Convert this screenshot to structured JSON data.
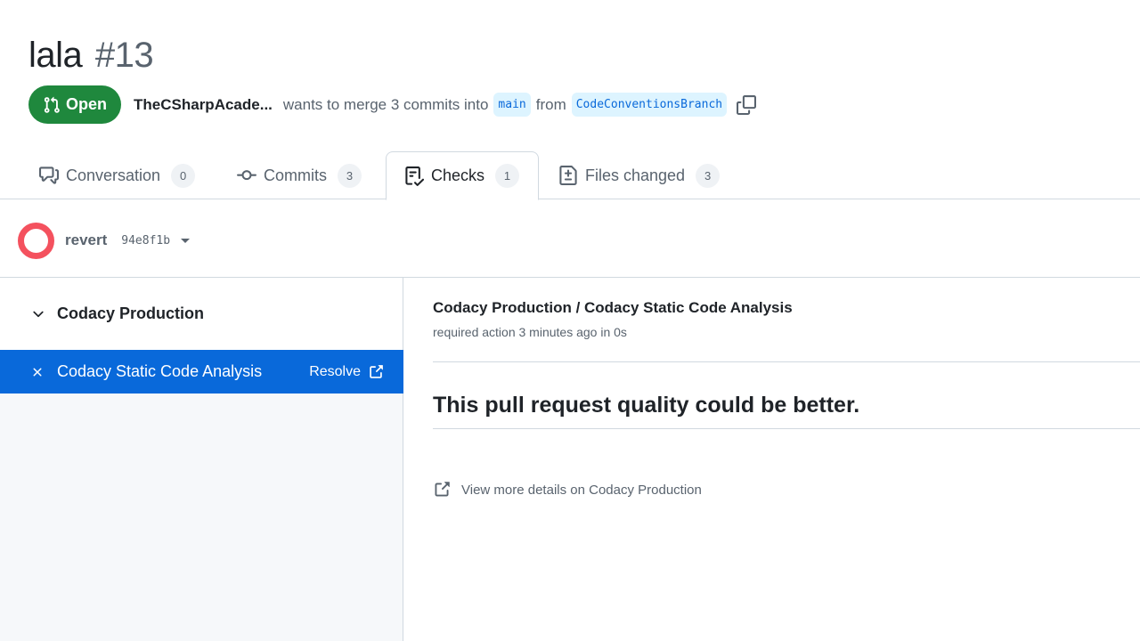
{
  "header": {
    "title": "lala",
    "number": "#13",
    "state": "Open",
    "author": "TheCSharpAcade...",
    "merge_text": "wants to merge 3 commits into",
    "base_branch": "main",
    "from_text": "from",
    "head_branch": "CodeConventionsBranch"
  },
  "tabs": [
    {
      "label": "Conversation",
      "count": "0",
      "icon": "comment-discussion-icon"
    },
    {
      "label": "Commits",
      "count": "3",
      "icon": "git-commit-icon"
    },
    {
      "label": "Checks",
      "count": "1",
      "icon": "checklist-icon",
      "active": true
    },
    {
      "label": "Files changed",
      "count": "3",
      "icon": "file-diff-icon"
    }
  ],
  "commit": {
    "message": "revert",
    "sha": "94e8f1b",
    "status_color": "#f4515e"
  },
  "sidebar": {
    "suite_name": "Codacy Production",
    "run_name": "Codacy Static Code Analysis",
    "resolve_label": "Resolve"
  },
  "detail": {
    "title": "Codacy Production / Codacy Static Code Analysis",
    "subtitle": "required action 3 minutes ago in 0s",
    "summary": "This pull request quality could be better.",
    "more_link": "View more details on Codacy Production"
  },
  "colors": {
    "open_green": "#1f883d",
    "accent_blue": "#0969da",
    "fail_red": "#f4515e"
  }
}
